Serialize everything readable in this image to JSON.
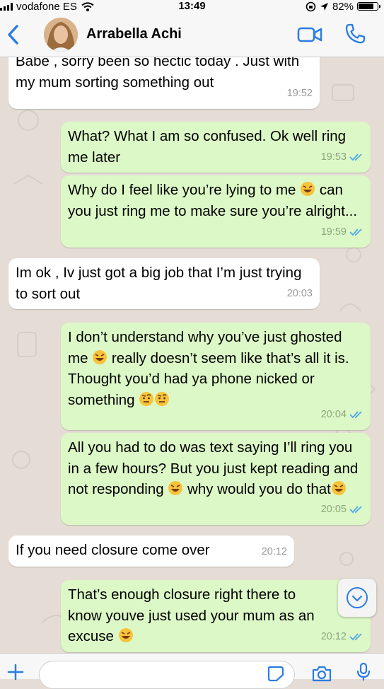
{
  "status_bar": {
    "carrier": "vodafone ES",
    "time": "13:49",
    "battery_text": "82%",
    "battery_level": 0.82
  },
  "header": {
    "contact_name": "Arrabella  Achi",
    "icons": [
      "back-icon",
      "avatar",
      "video-call-icon",
      "phone-icon"
    ]
  },
  "messages": [
    {
      "dir": "in",
      "text": "Babe , sorry been so hectic today . Just with my mum sorting something out",
      "time": "19:52"
    },
    {
      "dir": "out",
      "text": "What? What I am so confused. Ok well ring me later",
      "time": "19:53"
    },
    {
      "dir": "out",
      "text": "Why do I feel like you’re lying to me 🤣 can you just ring me to make sure you’re alright...",
      "time": "19:59"
    },
    {
      "dir": "in",
      "text": "Im ok , Iv just got a big job that I’m just trying to sort out",
      "time": "20:03"
    },
    {
      "dir": "out",
      "text": "I don’t understand why you’ve just ghosted me 🤣 really doesn’t seem like that’s all it is. Thought you’d had ya phone nicked or something 🤨🤨",
      "time": "20:04"
    },
    {
      "dir": "out",
      "text": "All you had to do was text saying I’ll ring you in a few hours? But you just kept reading and not responding 🤣 why would you do that🤣",
      "time": "20:05"
    },
    {
      "dir": "in",
      "text": "If you need closure come over",
      "time": "20:12"
    },
    {
      "dir": "out",
      "text": "That’s enough closure right there to know youve just used your mum as an excuse 🤣",
      "time": "20:12"
    }
  ],
  "input": {
    "placeholder": ""
  },
  "colors": {
    "outgoing_bubble": "#dcf8c6",
    "incoming_bubble": "#ffffff",
    "chat_background": "#e5ddd5",
    "accent": "#2a7de1",
    "read_ticks": "#4fa8e8"
  }
}
